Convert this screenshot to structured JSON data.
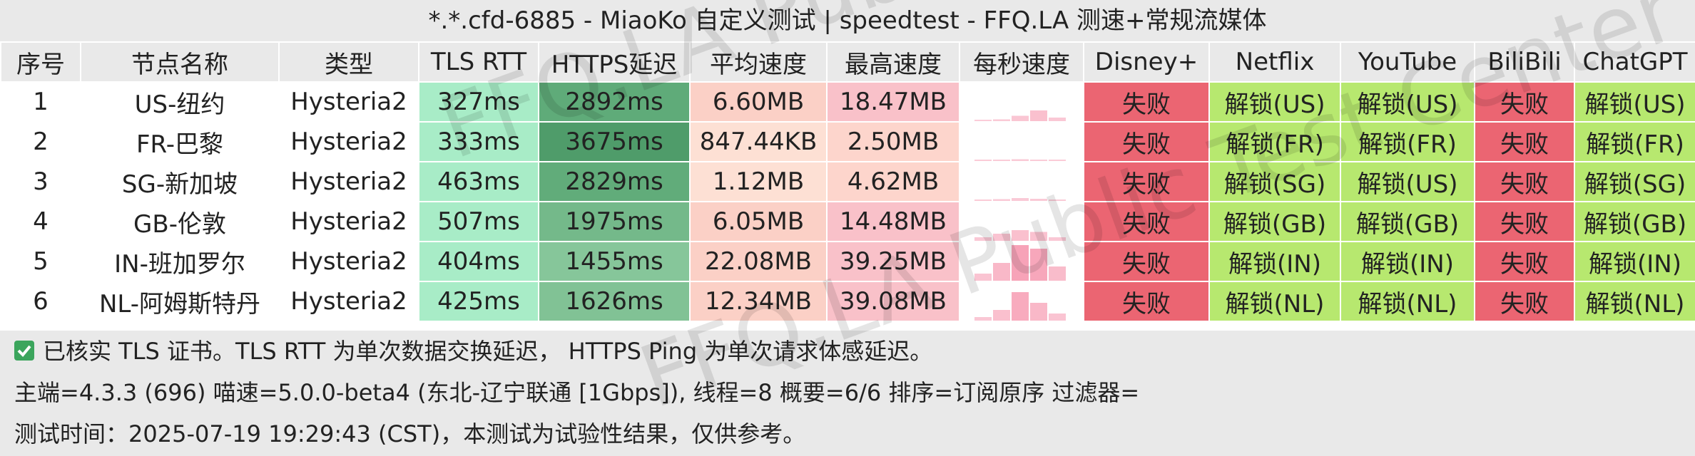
{
  "title": "*.*.cfd-6885 - MiaoKo 自定义测试 | speedtest - FFQ.LA 测速+常规流媒体",
  "columns": [
    "序号",
    "节点名称",
    "类型",
    "TLS RTT",
    "HTTPS延迟",
    "平均速度",
    "最高速度",
    "每秒速度",
    "Disney+",
    "Netflix",
    "YouTube",
    "BiliBili",
    "ChatGPT"
  ],
  "rows": [
    {
      "idx": "1",
      "name": "US-纽约",
      "type": "Hysteria2",
      "tls": "327ms",
      "https": "2892ms",
      "avg": "6.60MB",
      "max": "18.47MB",
      "disney": "失败",
      "netflix": "解锁(US)",
      "youtube": "解锁(US)",
      "bili": "失败",
      "chatgpt": "解锁(US)",
      "https_color": "#5fab79",
      "spark": [
        0,
        0.05,
        0.15,
        0.3,
        0.1
      ]
    },
    {
      "idx": "2",
      "name": "FR-巴黎",
      "type": "Hysteria2",
      "tls": "333ms",
      "https": "3675ms",
      "avg": "847.44KB",
      "max": "2.50MB",
      "disney": "失败",
      "netflix": "解锁(FR)",
      "youtube": "解锁(FR)",
      "bili": "失败",
      "chatgpt": "解锁(FR)",
      "https_color": "#4f9c6a",
      "spark": [
        0.02,
        0.04,
        0.05,
        0.03,
        0.02
      ]
    },
    {
      "idx": "3",
      "name": "SG-新加坡",
      "type": "Hysteria2",
      "tls": "463ms",
      "https": "2829ms",
      "avg": "1.12MB",
      "max": "4.62MB",
      "disney": "失败",
      "netflix": "解锁(SG)",
      "youtube": "解锁(US)",
      "bili": "失败",
      "chatgpt": "解锁(SG)",
      "https_color": "#61ac7a",
      "spark": [
        0.02,
        0.05,
        0.08,
        0.06,
        0.03
      ]
    },
    {
      "idx": "4",
      "name": "GB-伦敦",
      "type": "Hysteria2",
      "tls": "507ms",
      "https": "1975ms",
      "avg": "6.05MB",
      "max": "14.48MB",
      "disney": "失败",
      "netflix": "解锁(GB)",
      "youtube": "解锁(GB)",
      "bili": "失败",
      "chatgpt": "解锁(GB)",
      "https_color": "#74b98a",
      "spark": [
        0.1,
        0.2,
        0.3,
        0.25,
        0.1
      ]
    },
    {
      "idx": "5",
      "name": "IN-班加罗尔",
      "type": "Hysteria2",
      "tls": "404ms",
      "https": "1455ms",
      "avg": "22.08MB",
      "max": "39.25MB",
      "disney": "失败",
      "netflix": "解锁(IN)",
      "youtube": "解锁(IN)",
      "bili": "失败",
      "chatgpt": "解锁(IN)",
      "https_color": "#86c69a",
      "spark": [
        0.2,
        0.5,
        1.0,
        0.9,
        0.4
      ]
    },
    {
      "idx": "6",
      "name": "NL-阿姆斯特丹",
      "type": "Hysteria2",
      "tls": "425ms",
      "https": "1626ms",
      "avg": "12.34MB",
      "max": "39.08MB",
      "disney": "失败",
      "netflix": "解锁(NL)",
      "youtube": "解锁(NL)",
      "bili": "失败",
      "chatgpt": "解锁(NL)",
      "https_color": "#81c295",
      "spark": [
        0.1,
        0.3,
        0.8,
        0.5,
        0.2
      ]
    }
  ],
  "footer": {
    "note": "已核实 TLS 证书。TLS RTT 为单次数据交换延迟， HTTPS Ping 为单次请求体感延迟。",
    "info": "主端=4.3.3 (696) 喵速=5.0.0-beta4 (东北-辽宁联通 [1Gbps]), 线程=8 概要=6/6 排序=订阅原序 过滤器=",
    "time": "测试时间：2025-07-19 19:29:43 (CST)，本测试为试验性结果，仅供参考。"
  },
  "watermark": "FFQ.LA Public Test Center",
  "colors": {
    "fail": "#eb6572",
    "unlock": "#b7e86f",
    "rtt": "#a8ecc7",
    "spark": "#f7a3b8"
  }
}
